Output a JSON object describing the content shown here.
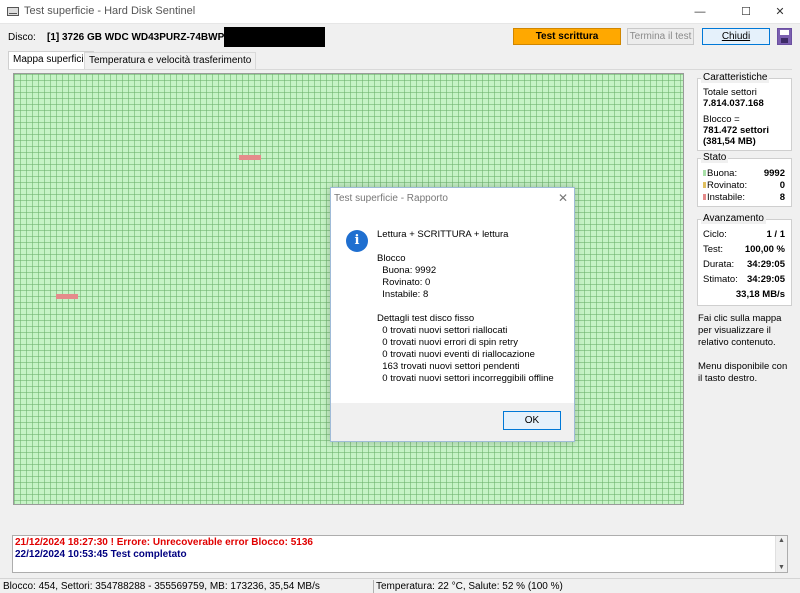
{
  "window": {
    "title": "Test superficie - Hard Disk Sentinel",
    "minimize_glyph": "—",
    "maximize_glyph": "☐",
    "close_glyph": "✕"
  },
  "toolbar": {
    "disk_label": "Disco:",
    "disk_value": "[1] 3726 GB  WDC WD43PURZ-74BWPY0",
    "write_test_button": "Test scrittura",
    "stop_test_button": "Termina il test",
    "close_button": "Chiudi",
    "save_icon": "floppy-disk-icon"
  },
  "tabs": [
    {
      "label": "Mappa superficie",
      "active": true
    },
    {
      "label": "Temperatura e velocità trasferimento",
      "active": false
    }
  ],
  "surface_map": {
    "block_color_good": "#c6f3c6",
    "block_color_unstable": "#e58b8b"
  },
  "characteristics": {
    "heading": "Caratteristiche",
    "total_sectors_label": "Totale settori",
    "total_sectors_value": "7.814.037.168",
    "block_label": "Blocco =",
    "block_sectors": "781.472 settori",
    "block_size": "(381,54 MB)"
  },
  "status": {
    "heading": "Stato",
    "good_label": "Buona:",
    "good_value": "9992",
    "damaged_label": "Rovinato:",
    "damaged_value": "0",
    "unstable_label": "Instabile:",
    "unstable_value": "8",
    "colors": {
      "good": "#a8e0a8",
      "damaged": "#e0c060",
      "unstable": "#e58b8b"
    }
  },
  "progress": {
    "heading": "Avanzamento",
    "cycle_label": "Ciclo:",
    "cycle_value": "1 / 1",
    "test_label": "Test:",
    "test_value": "100,00 %",
    "duration_label": "Durata:",
    "duration_value": "34:29:05",
    "estimated_label": "Stimato:",
    "estimated_value": "34:29:05",
    "speed_value": "33,18 MB/s"
  },
  "notes": {
    "map_click": "Fai clic sulla mappa per visualizzare il relativo contenuto.",
    "context_menu": "Menu disponibile con il tasto destro."
  },
  "log": {
    "error_line": "21/12/2024  18:27:30 ! Errore: Unrecoverable error Blocco: 5136",
    "ok_line": "22/12/2024  10:53:45   Test completato"
  },
  "statusbar": {
    "left": "Blocco: 454, Settori: 354788288 - 355569759, MB: 173236, 35,54 MB/s",
    "right": "Temperatura: 22  °C,  Salute: 52 % (100 %)"
  },
  "dialog": {
    "title": "Test superficie - Rapporto",
    "close_glyph": "✕",
    "info_glyph": "i",
    "message": "Lettura + SCRITTURA + lettura\n\nBlocco\n  Buona: 9992\n  Rovinato: 0\n  Instabile: 8\n\nDettagli test disco fisso\n  0 trovati nuovi settori riallocati\n  0 trovati nuovi errori di spin retry\n  0 trovati nuovi eventi di riallocazione\n  163 trovati nuovi settori pendenti\n  0 trovati nuovi settori incorreggibili offline",
    "ok_button": "OK"
  }
}
